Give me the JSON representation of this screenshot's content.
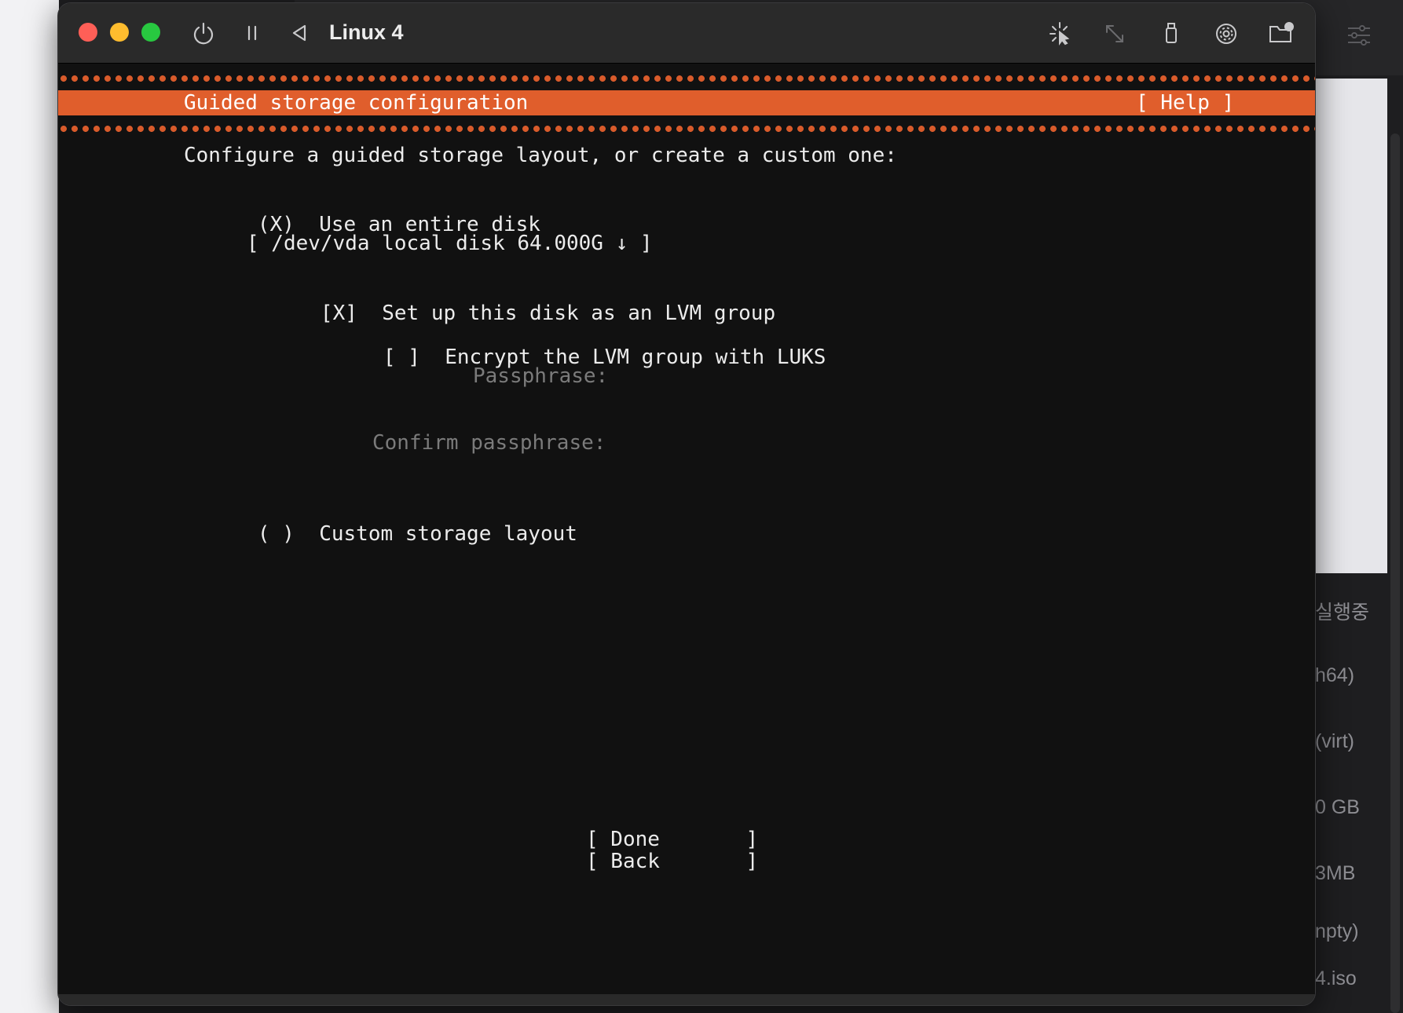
{
  "background": {
    "info_lines": [
      "실행중",
      "h64)",
      "(virt)",
      "0 GB",
      "3MB",
      "npty)",
      "4.iso"
    ]
  },
  "window": {
    "title": "Linux 4",
    "toolbar_icons": [
      "power-icon",
      "pause-icon",
      "back-icon",
      "cursor-capture-icon",
      "resize-icon",
      "usb-icon",
      "disc-icon",
      "shared-folder-icon"
    ]
  },
  "installer": {
    "header_title": "Guided storage configuration",
    "help_label": "[ Help ]",
    "intro": "Configure a guided storage layout, or create a custom one:",
    "entire_disk": {
      "marker": "(X)",
      "label": "Use an entire disk"
    },
    "disk_select": "[ /dev/vda local disk 64.000G ↓ ]",
    "lvm": {
      "marker": "[X]",
      "label": "Set up this disk as an LVM group"
    },
    "luks": {
      "marker": "[ ]",
      "label": "Encrypt the LVM group with LUKS"
    },
    "passphrase_label": "Passphrase:",
    "confirm_passphrase_label": "Confirm passphrase:",
    "custom": {
      "marker": "( )",
      "label": "Custom storage layout"
    },
    "done_button": "[ Done       ]",
    "back_button": "[ Back       ]"
  },
  "colors": {
    "accent_orange": "#e05e2c",
    "terminal_bg": "#111111",
    "text": "#ececec",
    "dim_text": "#7b7b7b"
  }
}
